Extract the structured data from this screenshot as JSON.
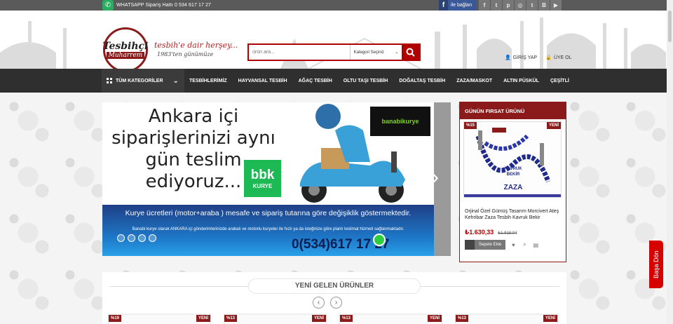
{
  "topbar": {
    "whatsapp_text": "WHATSAPP Sipariş Hattı 0 534 617 17 27",
    "facebook_label": "ile bağlan",
    "social_icons": [
      "facebook-icon",
      "twitter-icon",
      "pinterest-icon",
      "instagram-icon",
      "tumblr-icon",
      "blogger-icon",
      "youtube-icon"
    ]
  },
  "header": {
    "logo_line1": "Tesbihçi",
    "logo_line2": "Muharrem",
    "tagline": "tesbih'e dair herşey...",
    "tagline2": "1983'ten günümüze",
    "search_placeholder": "ürün ara...",
    "category_select": "Kategori Seçiniz",
    "login": "GİRİŞ YAP",
    "register": "ÜYE OL"
  },
  "nav": {
    "all_categories": "TÜM KATEGORİLER",
    "items": [
      "TESBİHLERİMİZ",
      "HAYVANSAL TESBİH",
      "AĞAÇ TESBİH",
      "OLTU TAŞI TESBİH",
      "DOĞALTAŞ TESBİH",
      "ZAZA/MASKOT",
      "ALTIN PÜSKÜL",
      "ÇEŞİTLİ"
    ]
  },
  "slider": {
    "headline": "Ankara içi siparişlerinizi aynı gün teslim ediyoruz...",
    "bbk_main": "bbk",
    "bbk_sub": "KURYE",
    "banabi": "banabikurye",
    "line1": "Kurye ücretleri (motor+araba ) mesafe ve sipariş tutarına göre değişiklik göstermektedir.",
    "line2": "Banabi kurye olarak ANKARA içi gönderimlerinizde arabalı ve motorlu kuryeler ile hızlı ya da isteğinize göre planlı teslimat hizmeti sağlanmaktadır.",
    "phone": "0(534)617 17 27",
    "dots": 4
  },
  "deal": {
    "heading": "GÜNÜN FIRSAT ÜRÜNÜ",
    "discount": "%15",
    "new_badge": "YENİ",
    "title": "Orjinal Özel Gümüş Tasarım Morcivert Ateş Kehribar Zaza Tesbih Kavruk Bekir",
    "price": "₺1.630,33",
    "old_price": "₺1.918,04",
    "cart_label": "Sepete Ekle",
    "img_text1": "KAVRUK",
    "img_text2": "BEKİR",
    "img_text3": "ZAZA"
  },
  "new_products": {
    "heading": "YENİ GELEN ÜRÜNLER",
    "cards": [
      {
        "discount": "%19",
        "badge": "YENİ"
      },
      {
        "discount": "%13",
        "badge": "YENİ"
      },
      {
        "discount": "%13",
        "badge": "YENİ"
      },
      {
        "discount": "%13",
        "badge": "YENİ"
      }
    ]
  },
  "scroll_top": "Başa Dön",
  "colors": {
    "brand_red": "#8b1a1a",
    "accent_red": "#b00000",
    "nav_dark": "#2f2f2f",
    "facebook": "#3b5998",
    "whatsapp": "#27ae60"
  }
}
